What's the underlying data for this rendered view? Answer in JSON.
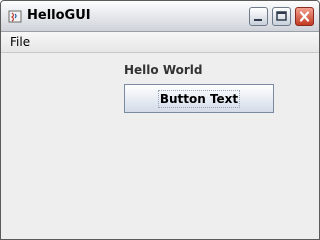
{
  "window": {
    "title": "HelloGUI",
    "controls": {
      "minimize_icon": "minimize-icon",
      "maximize_icon": "maximize-icon",
      "close_icon": "close-icon"
    }
  },
  "menubar": {
    "items": [
      {
        "label": "File"
      }
    ]
  },
  "content": {
    "label": "Hello World",
    "button_label": "Button Text"
  },
  "colors": {
    "window_background": "#eeeeee",
    "close_button": "#c23a22",
    "text": "#000000"
  }
}
